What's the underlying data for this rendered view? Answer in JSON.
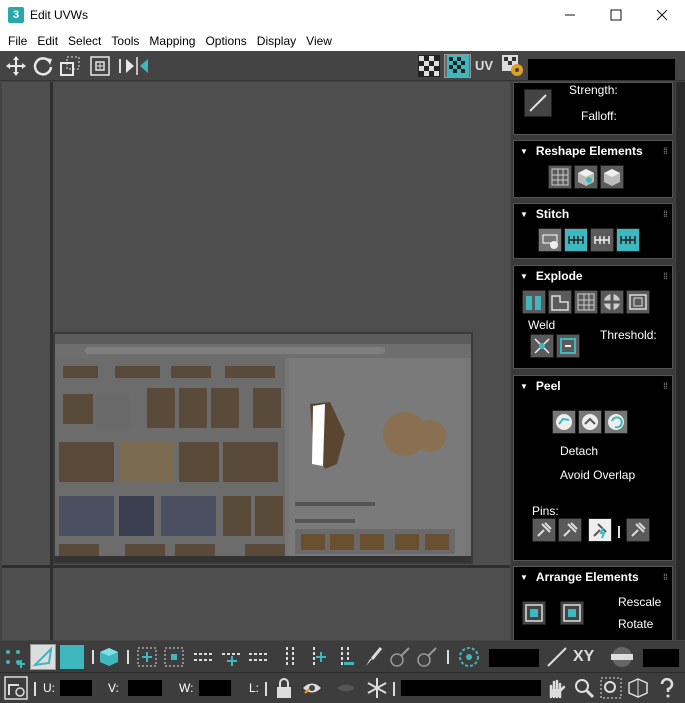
{
  "window": {
    "title": "Edit UVWs",
    "app_icon": "3",
    "controls": {
      "minimize": "—",
      "maximize": "☐",
      "close": "✕"
    }
  },
  "menu": [
    "File",
    "Edit",
    "Select",
    "Tools",
    "Mapping",
    "Options",
    "Display",
    "View"
  ],
  "toolbar": {
    "uv_label": "UV",
    "icons": [
      "move-icon",
      "rotate-icon",
      "scale-icon",
      "freeform-icon",
      "mirror-icon",
      "checker-icon",
      "checker-pattern-icon",
      "uv-settings-icon"
    ]
  },
  "panel": {
    "soft_selection": {
      "strength_label": "Strength:",
      "falloff_label": "Falloff:"
    },
    "reshape": {
      "title": "Reshape Elements"
    },
    "stitch": {
      "title": "Stitch"
    },
    "explode": {
      "title": "Explode",
      "weld_label": "Weld",
      "threshold_label": "Threshold:"
    },
    "peel": {
      "title": "Peel",
      "detach_label": "Detach",
      "avoid_overlap_label": "Avoid Overlap",
      "pins_label": "Pins:"
    },
    "arrange": {
      "title": "Arrange Elements",
      "rescale_label": "Rescale",
      "rotate_label": "Rotate"
    }
  },
  "bottom": {
    "xy_label": "XY",
    "u_label": "U:",
    "v_label": "V:",
    "w_label": "W:",
    "l_label": "L:"
  },
  "colors": {
    "accent": "#3fb7be",
    "background": "#444444",
    "panel": "#000000"
  }
}
